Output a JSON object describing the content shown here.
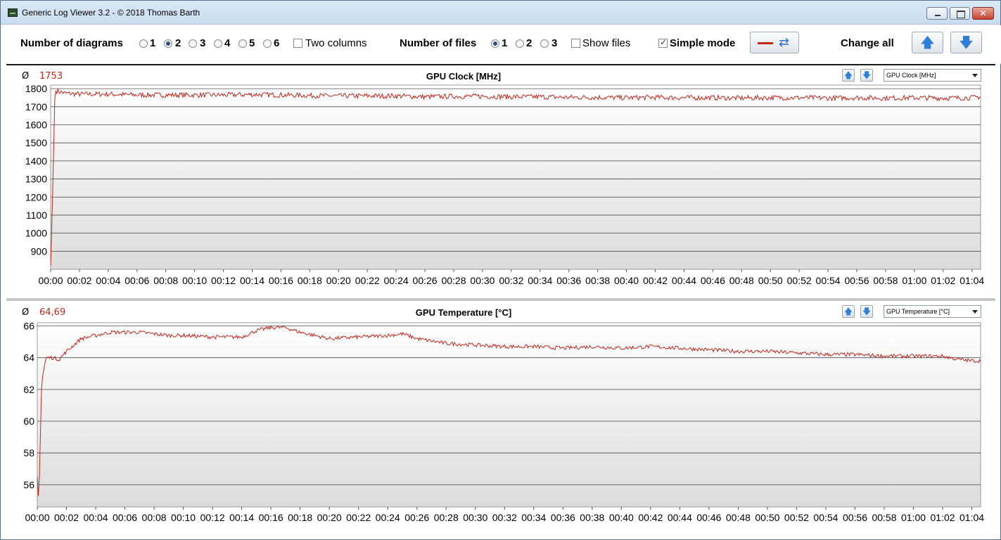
{
  "window": {
    "title": "Generic Log Viewer 3.2 - © 2018 Thomas Barth",
    "close_symbol": "✕"
  },
  "toolbar": {
    "diagrams_label": "Number of diagrams",
    "diagram_options": [
      "1",
      "2",
      "3",
      "4",
      "5",
      "6"
    ],
    "diagrams_selected": "2",
    "two_columns_label": "Two columns",
    "two_columns_checked": false,
    "files_label": "Number of files",
    "file_options": [
      "1",
      "2",
      "3"
    ],
    "files_selected": "1",
    "show_files_label": "Show files",
    "show_files_checked": false,
    "simple_mode_label": "Simple mode",
    "simple_mode_checked": true,
    "change_all_label": "Change all",
    "up_symbol": "🡅",
    "down_symbol": "🡇",
    "refresh_symbol": "⇄"
  },
  "charts": [
    {
      "avg_symbol": "Ø",
      "avg_value": "1753",
      "title": "GPU Clock [MHz]",
      "selector_value": "GPU Clock [MHz]"
    },
    {
      "avg_symbol": "Ø",
      "avg_value": "64,69",
      "title": "GPU Temperature [°C]",
      "selector_value": "GPU Temperature [°C]"
    }
  ],
  "chart_data": [
    {
      "type": "line",
      "title": "GPU Clock [MHz]",
      "x_ticks": [
        "00:00",
        "00:02",
        "00:04",
        "00:06",
        "00:08",
        "00:10",
        "00:12",
        "00:14",
        "00:16",
        "00:18",
        "00:20",
        "00:22",
        "00:24",
        "00:26",
        "00:28",
        "00:30",
        "00:32",
        "00:34",
        "00:36",
        "00:38",
        "00:40",
        "00:42",
        "00:44",
        "00:46",
        "00:48",
        "00:50",
        "00:52",
        "00:54",
        "00:56",
        "00:58",
        "01:00",
        "01:02",
        "01:04"
      ],
      "y_ticks": [
        900,
        1000,
        1100,
        1200,
        1300,
        1400,
        1500,
        1600,
        1700,
        1800
      ],
      "ylim": [
        800,
        1820
      ],
      "xlim_minutes": [
        0,
        64.6
      ],
      "grid": true,
      "series": [
        {
          "color": "#c0281c",
          "x_minutes": [
            0,
            0.15,
            0.3,
            1,
            2,
            4,
            6,
            8,
            10,
            12,
            14,
            16,
            18,
            20,
            22,
            24,
            26,
            28,
            30,
            32,
            34,
            36,
            38,
            40,
            42,
            44,
            46,
            48,
            50,
            52,
            54,
            56,
            58,
            60,
            62,
            64,
            64.5
          ],
          "values": [
            820,
            1250,
            1790,
            1775,
            1770,
            1770,
            1765,
            1765,
            1765,
            1765,
            1768,
            1765,
            1762,
            1760,
            1760,
            1760,
            1755,
            1758,
            1758,
            1755,
            1755,
            1752,
            1752,
            1750,
            1752,
            1750,
            1750,
            1748,
            1750,
            1750,
            1748,
            1750,
            1748,
            1750,
            1748,
            1750,
            1755
          ]
        }
      ]
    },
    {
      "type": "line",
      "title": "GPU Temperature [°C]",
      "x_ticks": [
        "00:00",
        "00:02",
        "00:04",
        "00:06",
        "00:08",
        "00:10",
        "00:12",
        "00:14",
        "00:16",
        "00:18",
        "00:20",
        "00:22",
        "00:24",
        "00:26",
        "00:28",
        "00:30",
        "00:32",
        "00:34",
        "00:36",
        "00:38",
        "00:40",
        "00:42",
        "00:44",
        "00:46",
        "00:48",
        "00:50",
        "00:52",
        "00:54",
        "00:56",
        "00:58",
        "01:00",
        "01:02",
        "01:04"
      ],
      "y_ticks": [
        56,
        58,
        60,
        62,
        64,
        66
      ],
      "ylim": [
        54.6,
        66.2
      ],
      "xlim_minutes": [
        0,
        64.6
      ],
      "grid": true,
      "series": [
        {
          "color": "#c0281c",
          "x_minutes": [
            0,
            0.1,
            0.3,
            0.6,
            1,
            1.5,
            2,
            3,
            4,
            5,
            6,
            7,
            8,
            9,
            10,
            12,
            14,
            15,
            16,
            17,
            18,
            19,
            20,
            22,
            24,
            25,
            26,
            28,
            30,
            32,
            34,
            36,
            38,
            40,
            42,
            44,
            46,
            48,
            50,
            52,
            54,
            56,
            58,
            60,
            62,
            63,
            64,
            64.5
          ],
          "values": [
            56.5,
            54.8,
            62.5,
            64.0,
            64.0,
            63.9,
            64.4,
            65.2,
            65.4,
            65.6,
            65.6,
            65.6,
            65.5,
            65.4,
            65.4,
            65.3,
            65.3,
            65.7,
            65.9,
            65.9,
            65.6,
            65.4,
            65.2,
            65.3,
            65.4,
            65.5,
            65.2,
            64.9,
            64.8,
            64.7,
            64.7,
            64.6,
            64.7,
            64.6,
            64.7,
            64.6,
            64.5,
            64.4,
            64.4,
            64.3,
            64.2,
            64.2,
            64.1,
            64.1,
            64.1,
            63.9,
            63.8,
            63.8
          ]
        }
      ]
    }
  ]
}
